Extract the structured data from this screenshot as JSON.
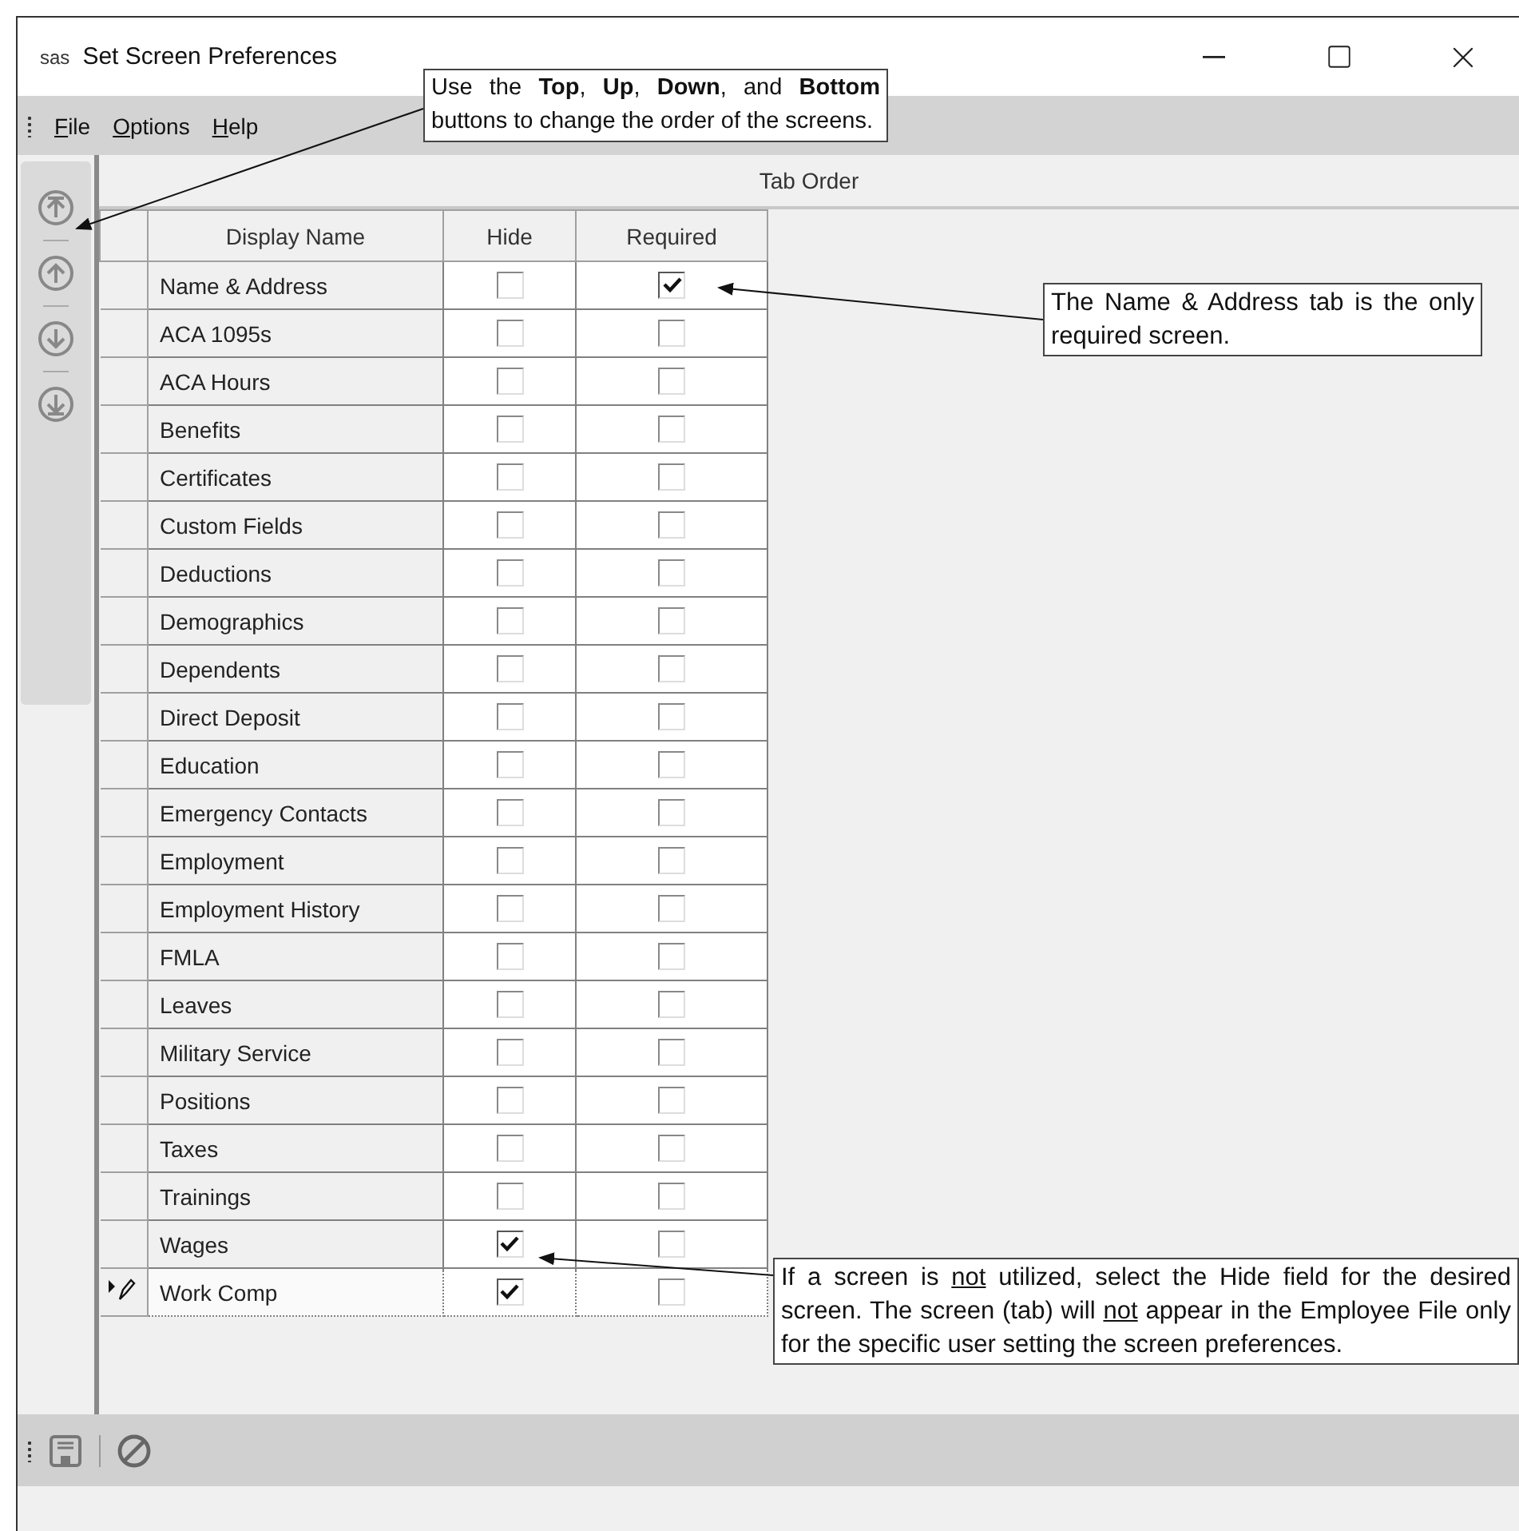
{
  "window": {
    "logo": "sas",
    "title": "Set Screen Preferences"
  },
  "menu": [
    "File",
    "Options",
    "Help"
  ],
  "group_title": "Tab Order",
  "columns": [
    "Display Name",
    "Hide",
    "Required"
  ],
  "rows": [
    {
      "name": "Name & Address",
      "hide": false,
      "required": true,
      "current": false
    },
    {
      "name": "ACA 1095s",
      "hide": false,
      "required": false,
      "current": false
    },
    {
      "name": "ACA Hours",
      "hide": false,
      "required": false,
      "current": false
    },
    {
      "name": "Benefits",
      "hide": false,
      "required": false,
      "current": false
    },
    {
      "name": "Certificates",
      "hide": false,
      "required": false,
      "current": false
    },
    {
      "name": "Custom Fields",
      "hide": false,
      "required": false,
      "current": false
    },
    {
      "name": "Deductions",
      "hide": false,
      "required": false,
      "current": false
    },
    {
      "name": "Demographics",
      "hide": false,
      "required": false,
      "current": false
    },
    {
      "name": "Dependents",
      "hide": false,
      "required": false,
      "current": false
    },
    {
      "name": "Direct Deposit",
      "hide": false,
      "required": false,
      "current": false
    },
    {
      "name": "Education",
      "hide": false,
      "required": false,
      "current": false
    },
    {
      "name": "Emergency Contacts",
      "hide": false,
      "required": false,
      "current": false
    },
    {
      "name": "Employment",
      "hide": false,
      "required": false,
      "current": false
    },
    {
      "name": "Employment History",
      "hide": false,
      "required": false,
      "current": false
    },
    {
      "name": "FMLA",
      "hide": false,
      "required": false,
      "current": false
    },
    {
      "name": "Leaves",
      "hide": false,
      "required": false,
      "current": false
    },
    {
      "name": "Military Service",
      "hide": false,
      "required": false,
      "current": false
    },
    {
      "name": "Positions",
      "hide": false,
      "required": false,
      "current": false
    },
    {
      "name": "Taxes",
      "hide": false,
      "required": false,
      "current": false
    },
    {
      "name": "Trainings",
      "hide": false,
      "required": false,
      "current": false
    },
    {
      "name": "Wages",
      "hide": true,
      "required": false,
      "current": false
    },
    {
      "name": "Work Comp",
      "hide": true,
      "required": false,
      "current": true
    }
  ],
  "callouts": [
    {
      "segments": [
        {
          "text": "Use the **Top**, **Up**, **Down**, and **Bottom** buttons to change the order of the screens.",
          "underlined": false
        }
      ]
    },
    {
      "segments": [
        {
          "text": "The Name & Address tab is the only required screen.",
          "underlined": false
        }
      ]
    },
    {
      "segments": [
        {
          "text": "If a screen is ",
          "underlined": false
        },
        {
          "text": "not",
          "underlined": true
        },
        {
          "text": " utilized, select the Hide field for the desired screen.  The screen (tab) will ",
          "underlined": false
        },
        {
          "text": "not",
          "underlined": true
        },
        {
          "text": " appear in the Employee File only for the specific user setting the screen preferences.",
          "underlined": false
        }
      ]
    }
  ]
}
